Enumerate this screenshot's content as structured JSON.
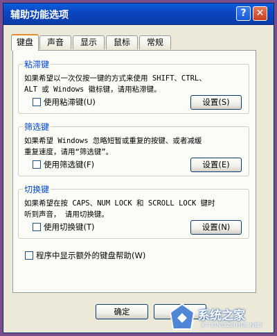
{
  "window": {
    "title": "辅助功能选项",
    "help_label": "?",
    "close_label": "✕"
  },
  "tabs": [
    {
      "label": "键盘",
      "active": true
    },
    {
      "label": "声音",
      "active": false
    },
    {
      "label": "显示",
      "active": false
    },
    {
      "label": "鼠标",
      "active": false
    },
    {
      "label": "常规",
      "active": false
    }
  ],
  "groups": {
    "sticky": {
      "title": "粘滞键",
      "description": "如果希望以一次仅按一键的方式来使用 SHIFT、CTRL、\nALT 或 Windows 徽标键，请用粘滞键。",
      "checkbox_label": "使用粘滞键(U)",
      "checked": false,
      "settings_label": "设置(S)"
    },
    "filter": {
      "title": "筛选键",
      "description": "如果希望 Windows 忽略短暂或重复的按键、或者减缓\n重复速度，请用“筛选键”。",
      "checkbox_label": "使用筛选键(F)",
      "checked": false,
      "settings_label": "设置(E)"
    },
    "toggle": {
      "title": "切换键",
      "description": "如果希望在按 CAPS、NUM LOCK 和 SCROLL LOCK 键时\n听到声音， 请用切换键。",
      "checkbox_label": "使用切换键(T)",
      "checked": false,
      "settings_label": "设置(N)"
    }
  },
  "extra_help": {
    "label": "程序中显示额外的键盘帮助(W)",
    "checked": false
  },
  "footer": {
    "ok_label": "确定"
  },
  "watermark": {
    "text": "系统之家",
    "sub": "XITONGZHIJIA.NET"
  }
}
